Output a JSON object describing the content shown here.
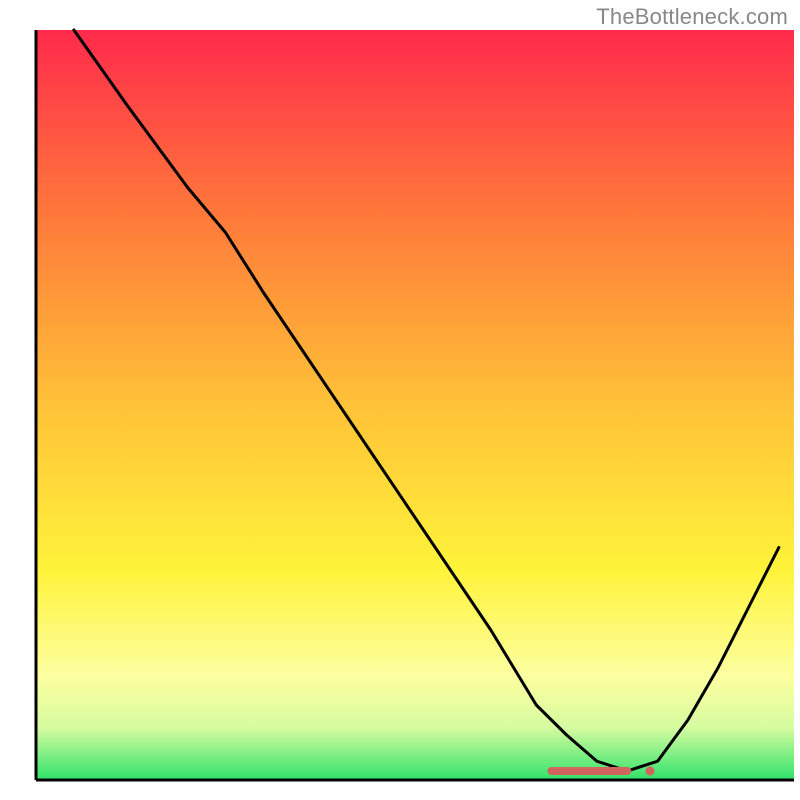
{
  "attribution": "TheBottleneck.com",
  "colors": {
    "gradient_top": "#ff2a4b",
    "gradient_upper_mid": "#ff7a3a",
    "gradient_mid": "#ffc238",
    "gradient_lower_mid": "#fff33a",
    "gradient_low": "#fdffa0",
    "gradient_near_bottom": "#d6fca0",
    "gradient_bottom": "#2fe36a",
    "curve": "#000000",
    "axis": "#000000",
    "marker": "#d1645f"
  },
  "chart_data": {
    "type": "line",
    "title": "",
    "xlabel": "",
    "ylabel": "",
    "xlim": [
      0,
      100
    ],
    "ylim": [
      0,
      100
    ],
    "grid": false,
    "legend": "none",
    "x": [
      5,
      12,
      20,
      25,
      30,
      35,
      40,
      45,
      50,
      55,
      60,
      63,
      66,
      70,
      74,
      78,
      82,
      86,
      90,
      94,
      98
    ],
    "values": [
      100,
      90,
      79,
      73,
      65,
      57.5,
      50,
      42.5,
      35,
      27.5,
      20,
      15,
      10,
      6,
      2.5,
      1.2,
      2.5,
      8,
      15,
      23,
      31
    ],
    "minimum_marker": {
      "x_start": 68,
      "x_end": 80,
      "y": 1.2
    },
    "annotations": []
  }
}
